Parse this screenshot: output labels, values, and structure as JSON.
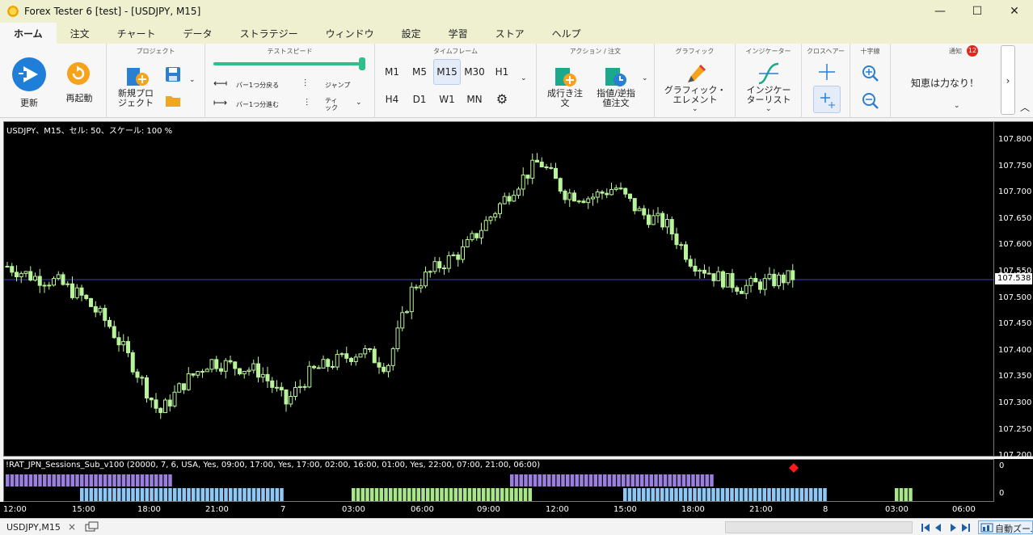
{
  "window": {
    "title": "Forex Tester 6  [test] - [USDJPY, M15]",
    "min": "—",
    "max": "☐",
    "close": "✕"
  },
  "menu_tabs": [
    "ホーム",
    "注文",
    "チャート",
    "データ",
    "ストラテジー",
    "ウィンドウ",
    "設定",
    "学習",
    "ストア",
    "ヘルプ"
  ],
  "ribbon": {
    "update_label": "更新",
    "restart_label": "再起動",
    "project": {
      "title": "プロジェクト",
      "new_label": "新規プロ\nジェクト"
    },
    "speed": {
      "title": "テストスピード",
      "back_label": "バー1つ分戻る",
      "fwd_label": "バー1つ分進む",
      "jump_label": "ジャンプ",
      "tick_label": "ティ\nック",
      "slider_value": 1.0
    },
    "timeframe": {
      "title": "タイムフレーム",
      "items": [
        "M1",
        "M5",
        "M15",
        "M30",
        "H1",
        "H4",
        "D1",
        "W1",
        "MN"
      ],
      "selected": "M15"
    },
    "action": {
      "title": "アクション / 注文",
      "market_label": "成行き注\n文",
      "pending_label": "指値/逆指\n値注文"
    },
    "graphic": {
      "title": "グラフィック",
      "label": "グラフィック・\nエレメント"
    },
    "indicator": {
      "title": "インジケーター",
      "label": "インジケー\nターリスト"
    },
    "crosshair_title": "クロスヘアー",
    "cross_title": "十字線",
    "notify": {
      "title": "通知",
      "badge": "12",
      "text": "知恵は力なり！"
    }
  },
  "chart": {
    "info": "USDJPY、M15、セル: 50、スケール: 100 %",
    "price_ticks": [
      "107.800",
      "107.750",
      "107.700",
      "107.650",
      "107.600",
      "107.550",
      "107.500",
      "107.450",
      "107.400",
      "107.350",
      "107.300",
      "107.250",
      "107.200"
    ],
    "current_price": "107.538",
    "indicator_label": "!RAT_JPN_Sessions_Sub_v100 (20000, 7, 6, USA, Yes, 09:00, 17:00, Yes, 17:00, 02:00, 16:00, 01:00, Yes, 22:00, 07:00, 21:00, 06:00)",
    "ind_ticks": [
      "0",
      "0"
    ],
    "time_ticks": [
      "12:00",
      "15:00",
      "18:00",
      "21:00",
      "7",
      "03:00",
      "06:00",
      "09:00",
      "12:00",
      "15:00",
      "18:00",
      "21:00",
      "8",
      "03:00",
      "06:00"
    ],
    "colors": {
      "up": "#b8f59a",
      "session_purple": "#9b7fe0",
      "session_blue": "#8ec8f4",
      "session_green": "#a8e68a",
      "marker": "#ff1a1a",
      "price_line": "#4040c0"
    }
  },
  "status": {
    "tab_label": "USDJPY,M15",
    "close": "×",
    "autozoom": "自動ズーム"
  },
  "chart_data": {
    "type": "candlestick",
    "symbol": "USDJPY",
    "timeframe": "M15",
    "ylim": [
      107.2,
      107.8
    ],
    "x": [
      "12:00",
      "15:00",
      "18:00",
      "21:00",
      "7",
      "03:00",
      "06:00",
      "09:00",
      "12:00",
      "15:00",
      "18:00",
      "21:00",
      "8"
    ],
    "series": [
      {
        "values": [
          107.56,
          107.54,
          107.53,
          107.5,
          107.45,
          107.37,
          107.28,
          107.34,
          107.38,
          107.37,
          107.36,
          107.3,
          107.36,
          107.38,
          107.4,
          107.37,
          107.52,
          107.56,
          107.59,
          107.65,
          107.71,
          107.76,
          107.7,
          107.69,
          107.71,
          107.66,
          107.64,
          107.57,
          107.54,
          107.52,
          107.53,
          107.54
        ]
      }
    ]
  }
}
